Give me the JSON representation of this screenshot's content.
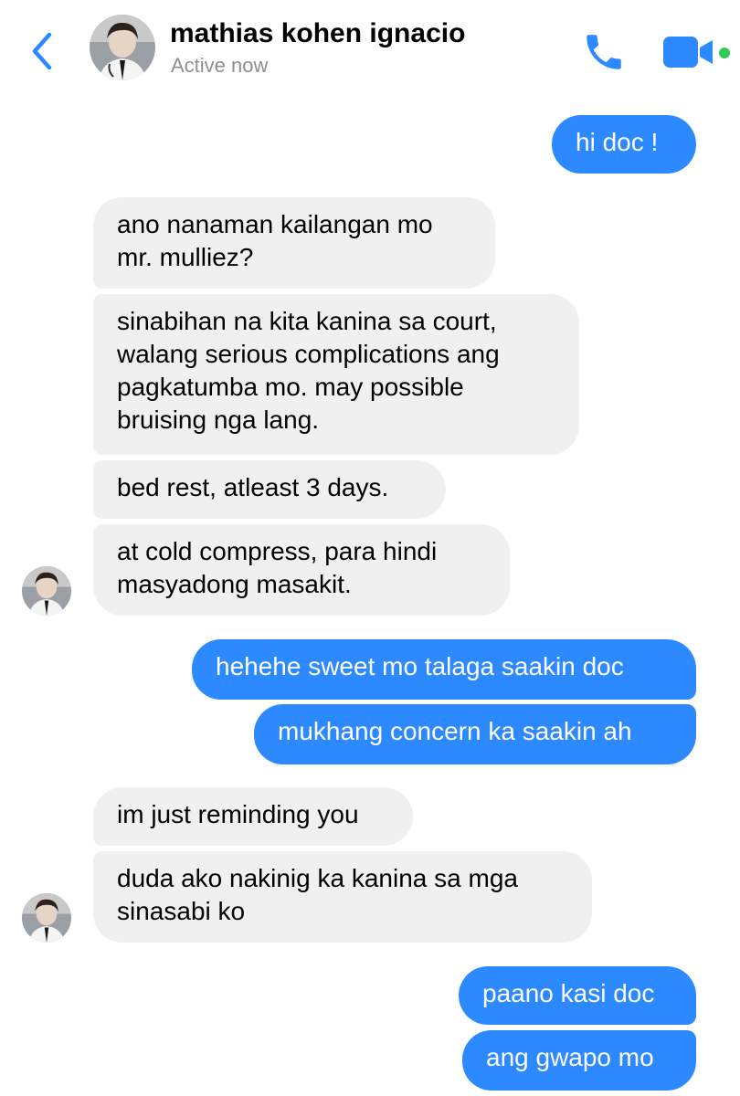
{
  "header": {
    "contact_name": "mathias kohen ignacio",
    "status": "Active now",
    "accent_color": "#2d89ff",
    "active_dot_color": "#34c759",
    "icons": [
      "chevron-left-icon",
      "phone-icon",
      "video-camera-icon"
    ]
  },
  "messages": [
    {
      "from": "me",
      "text": "hi doc !"
    },
    {
      "from": "them",
      "text": "ano nanaman kailangan mo\nmr. mulliez?"
    },
    {
      "from": "them",
      "text": "sinabihan na kita kanina sa court,\nwalang serious complications ang\npagkatumba mo. may possible\nbruising nga lang."
    },
    {
      "from": "them",
      "text": "bed rest, atleast 3 days."
    },
    {
      "from": "them",
      "text": "at cold compress, para hindi\nmasyadong masakit."
    },
    {
      "from": "me",
      "text": "hehehe sweet mo talaga saakin doc"
    },
    {
      "from": "me",
      "text": "mukhang concern ka saakin ah"
    },
    {
      "from": "them",
      "text": "im just reminding you"
    },
    {
      "from": "them",
      "text": "duda ako nakinig ka kanina sa mga\nsinasabi ko"
    },
    {
      "from": "me",
      "text": "paano kasi doc"
    },
    {
      "from": "me",
      "text": "ang gwapo mo"
    }
  ]
}
